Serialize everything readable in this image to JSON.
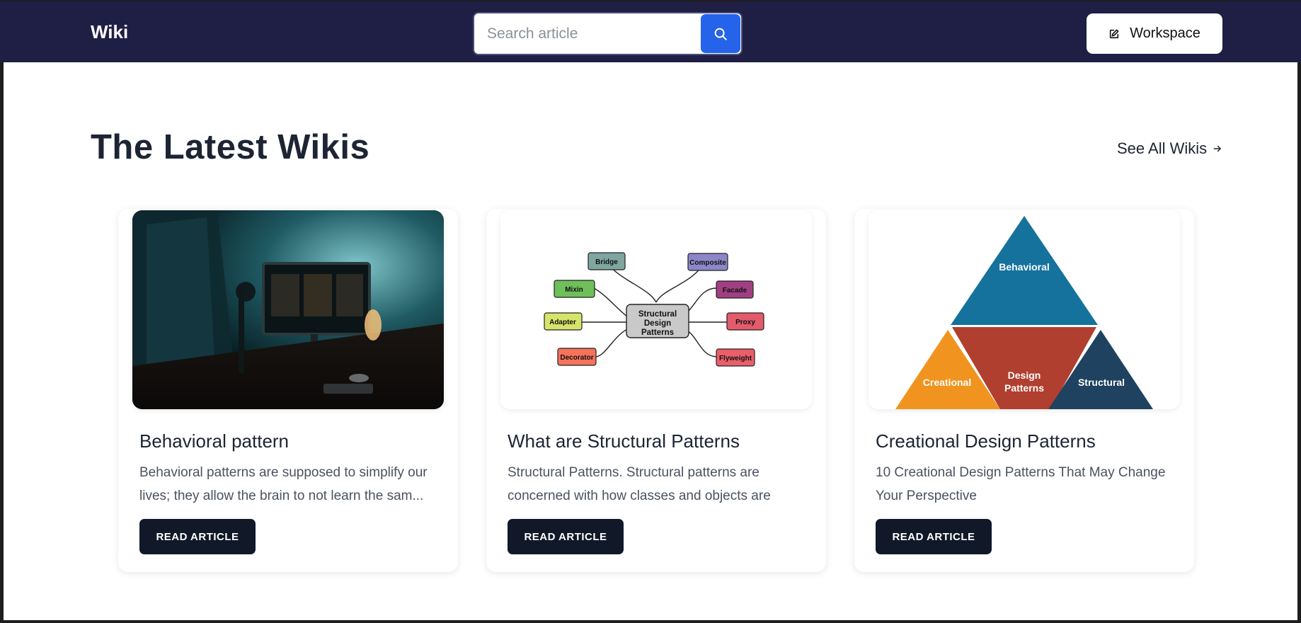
{
  "header": {
    "brand": "Wiki",
    "search_placeholder": "Search article",
    "workspace_label": "Workspace"
  },
  "section": {
    "title": "The Latest Wikis",
    "see_all_label": "See All Wikis"
  },
  "cards": [
    {
      "title": "Behavioral pattern",
      "description": "Behavioral patterns are supposed to simplify our lives; they allow the brain to not learn the sam...",
      "button_label": "READ ARTICLE"
    },
    {
      "title": "What are Structural Patterns",
      "description": "Structural Patterns. Structural patterns are concerned with how classes and objects are composed",
      "button_label": "READ ARTICLE",
      "diagram": {
        "center": "Structural Design Patterns",
        "nodes": [
          "Bridge",
          "Composite",
          "Mixin",
          "Facade",
          "Adapter",
          "Proxy",
          "Decorator",
          "Flyweight"
        ]
      }
    },
    {
      "title": "Creational Design Patterns",
      "description": "10 Creational Design Patterns That May Change Your Perspective",
      "button_label": "READ ARTICLE",
      "pyramid": {
        "top": "Behavioral",
        "left": "Creational",
        "middle": "Design Patterns",
        "right": "Structural"
      }
    }
  ],
  "colors": {
    "topbar": "#1f1e45",
    "search_button": "#2563eb",
    "read_button": "#111827"
  }
}
